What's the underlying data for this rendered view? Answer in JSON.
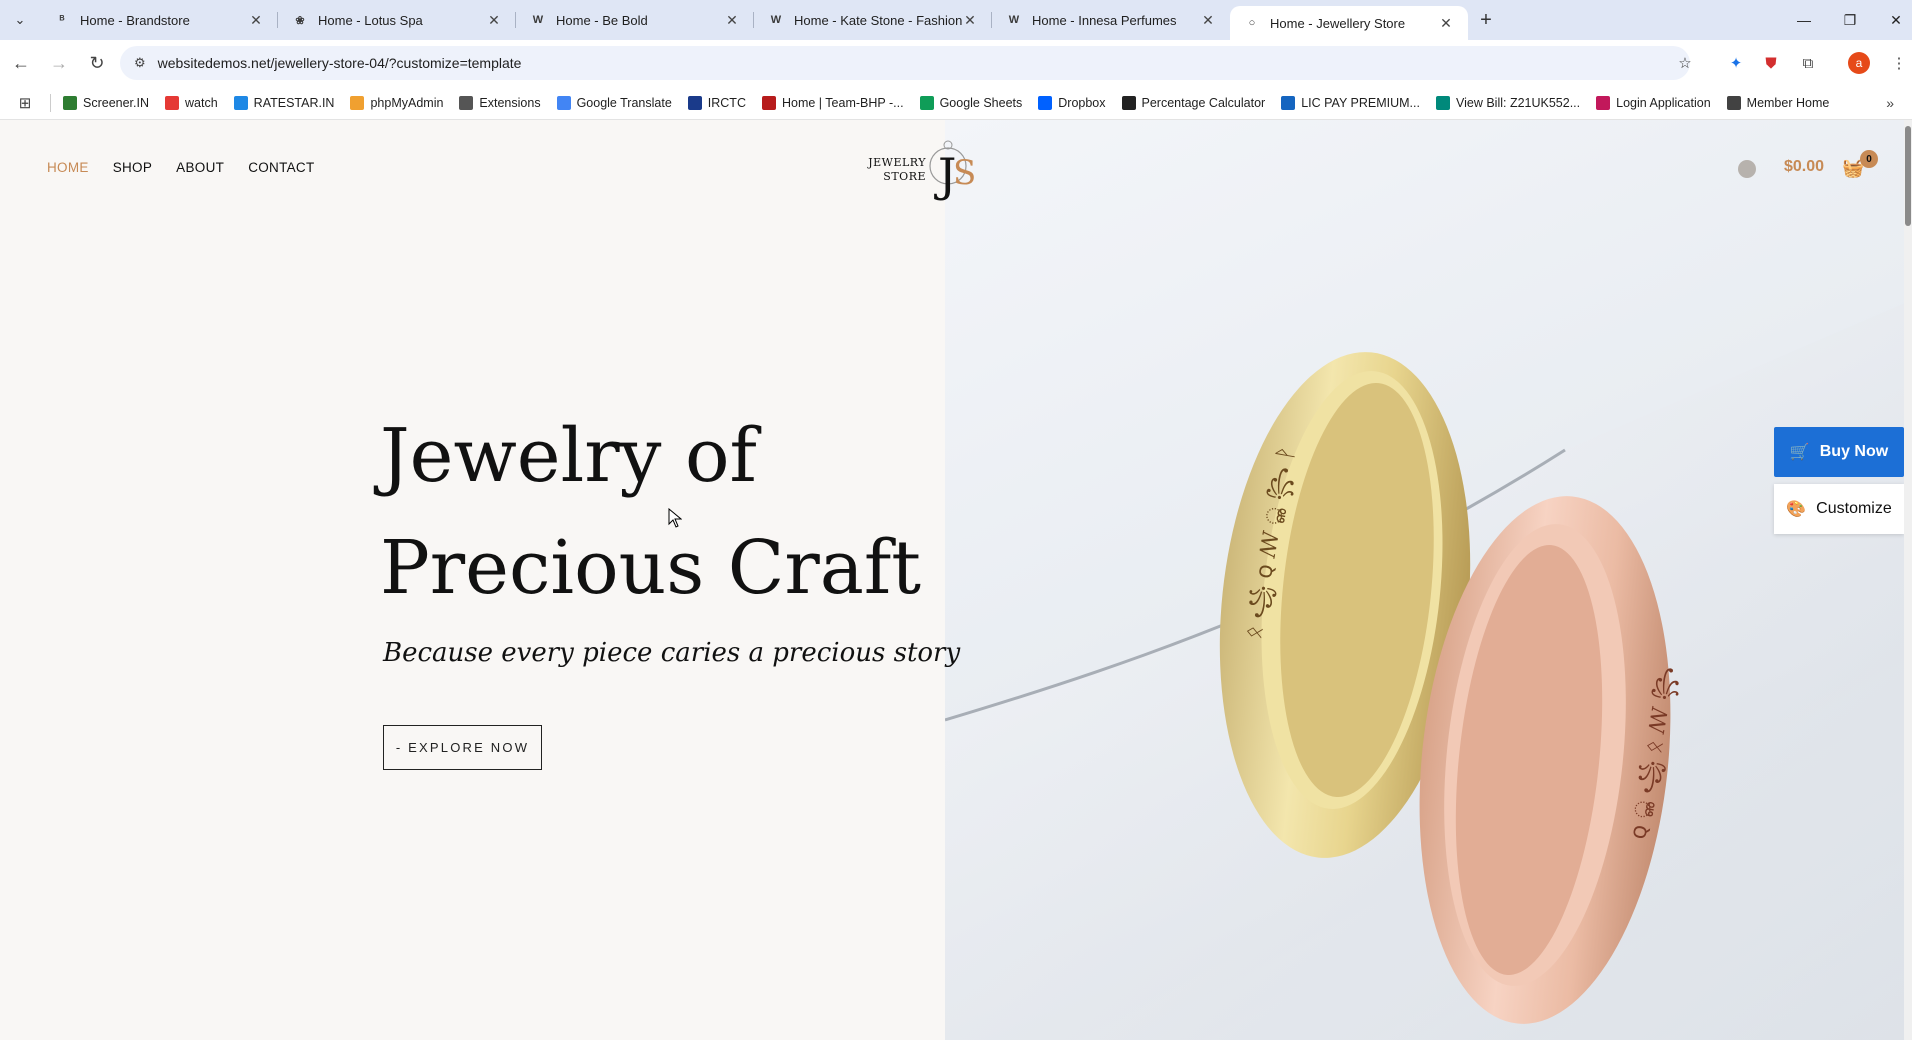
{
  "browser": {
    "tabs": [
      {
        "title": "Home - Brandstore",
        "favicon": "brand-icon",
        "active": false
      },
      {
        "title": "Home - Lotus Spa",
        "favicon": "lotus-icon",
        "active": false
      },
      {
        "title": "Home - Be Bold",
        "favicon": "wordpress-icon",
        "active": false
      },
      {
        "title": "Home - Kate Stone - Fashion De",
        "favicon": "wordpress-icon",
        "active": false
      },
      {
        "title": "Home - Innesa Perfumes",
        "favicon": "wordpress-icon",
        "active": false
      },
      {
        "title": "Home - Jewellery Store",
        "favicon": "ring-icon",
        "active": true
      }
    ],
    "url": "websitedemos.net/jewellery-store-04/?customize=template",
    "bookmarks": [
      {
        "label": "Screener.IN",
        "color": "#2e7d32"
      },
      {
        "label": "watch",
        "color": "#e53935"
      },
      {
        "label": "RATESTAR.IN",
        "color": "#1e88e5"
      },
      {
        "label": "phpMyAdmin",
        "color": "#f0a030"
      },
      {
        "label": "Extensions",
        "color": "#555555"
      },
      {
        "label": "Google Translate",
        "color": "#4285f4"
      },
      {
        "label": "IRCTC",
        "color": "#1a3a8a"
      },
      {
        "label": "Home | Team-BHP -...",
        "color": "#b71c1c"
      },
      {
        "label": "Google Sheets",
        "color": "#0f9d58"
      },
      {
        "label": "Dropbox",
        "color": "#0061ff"
      },
      {
        "label": "Percentage Calculator",
        "color": "#222222"
      },
      {
        "label": "LIC PAY PREMIUM...",
        "color": "#1565c0"
      },
      {
        "label": "View Bill: Z21UK552...",
        "color": "#00897b"
      },
      {
        "label": "Login Application",
        "color": "#c2185b"
      },
      {
        "label": "Member Home",
        "color": "#424242"
      }
    ],
    "profile_initial": "a"
  },
  "site": {
    "nav": [
      "HOME",
      "SHOP",
      "ABOUT",
      "CONTACT"
    ],
    "logo_text_1": "JEWELRY",
    "logo_text_2": "STORE",
    "logo_mark": "JS",
    "cart_total": "$0.00",
    "cart_count": "0",
    "headline_1": "Jewelry of",
    "headline_2": "Precious Craft",
    "subline": "Because every piece caries a precious story",
    "cta": "- EXPLORE NOW",
    "buy_now": "Buy Now",
    "customize": "Customize",
    "accent_color": "#c78a55",
    "button_blue": "#1c6fd6"
  }
}
